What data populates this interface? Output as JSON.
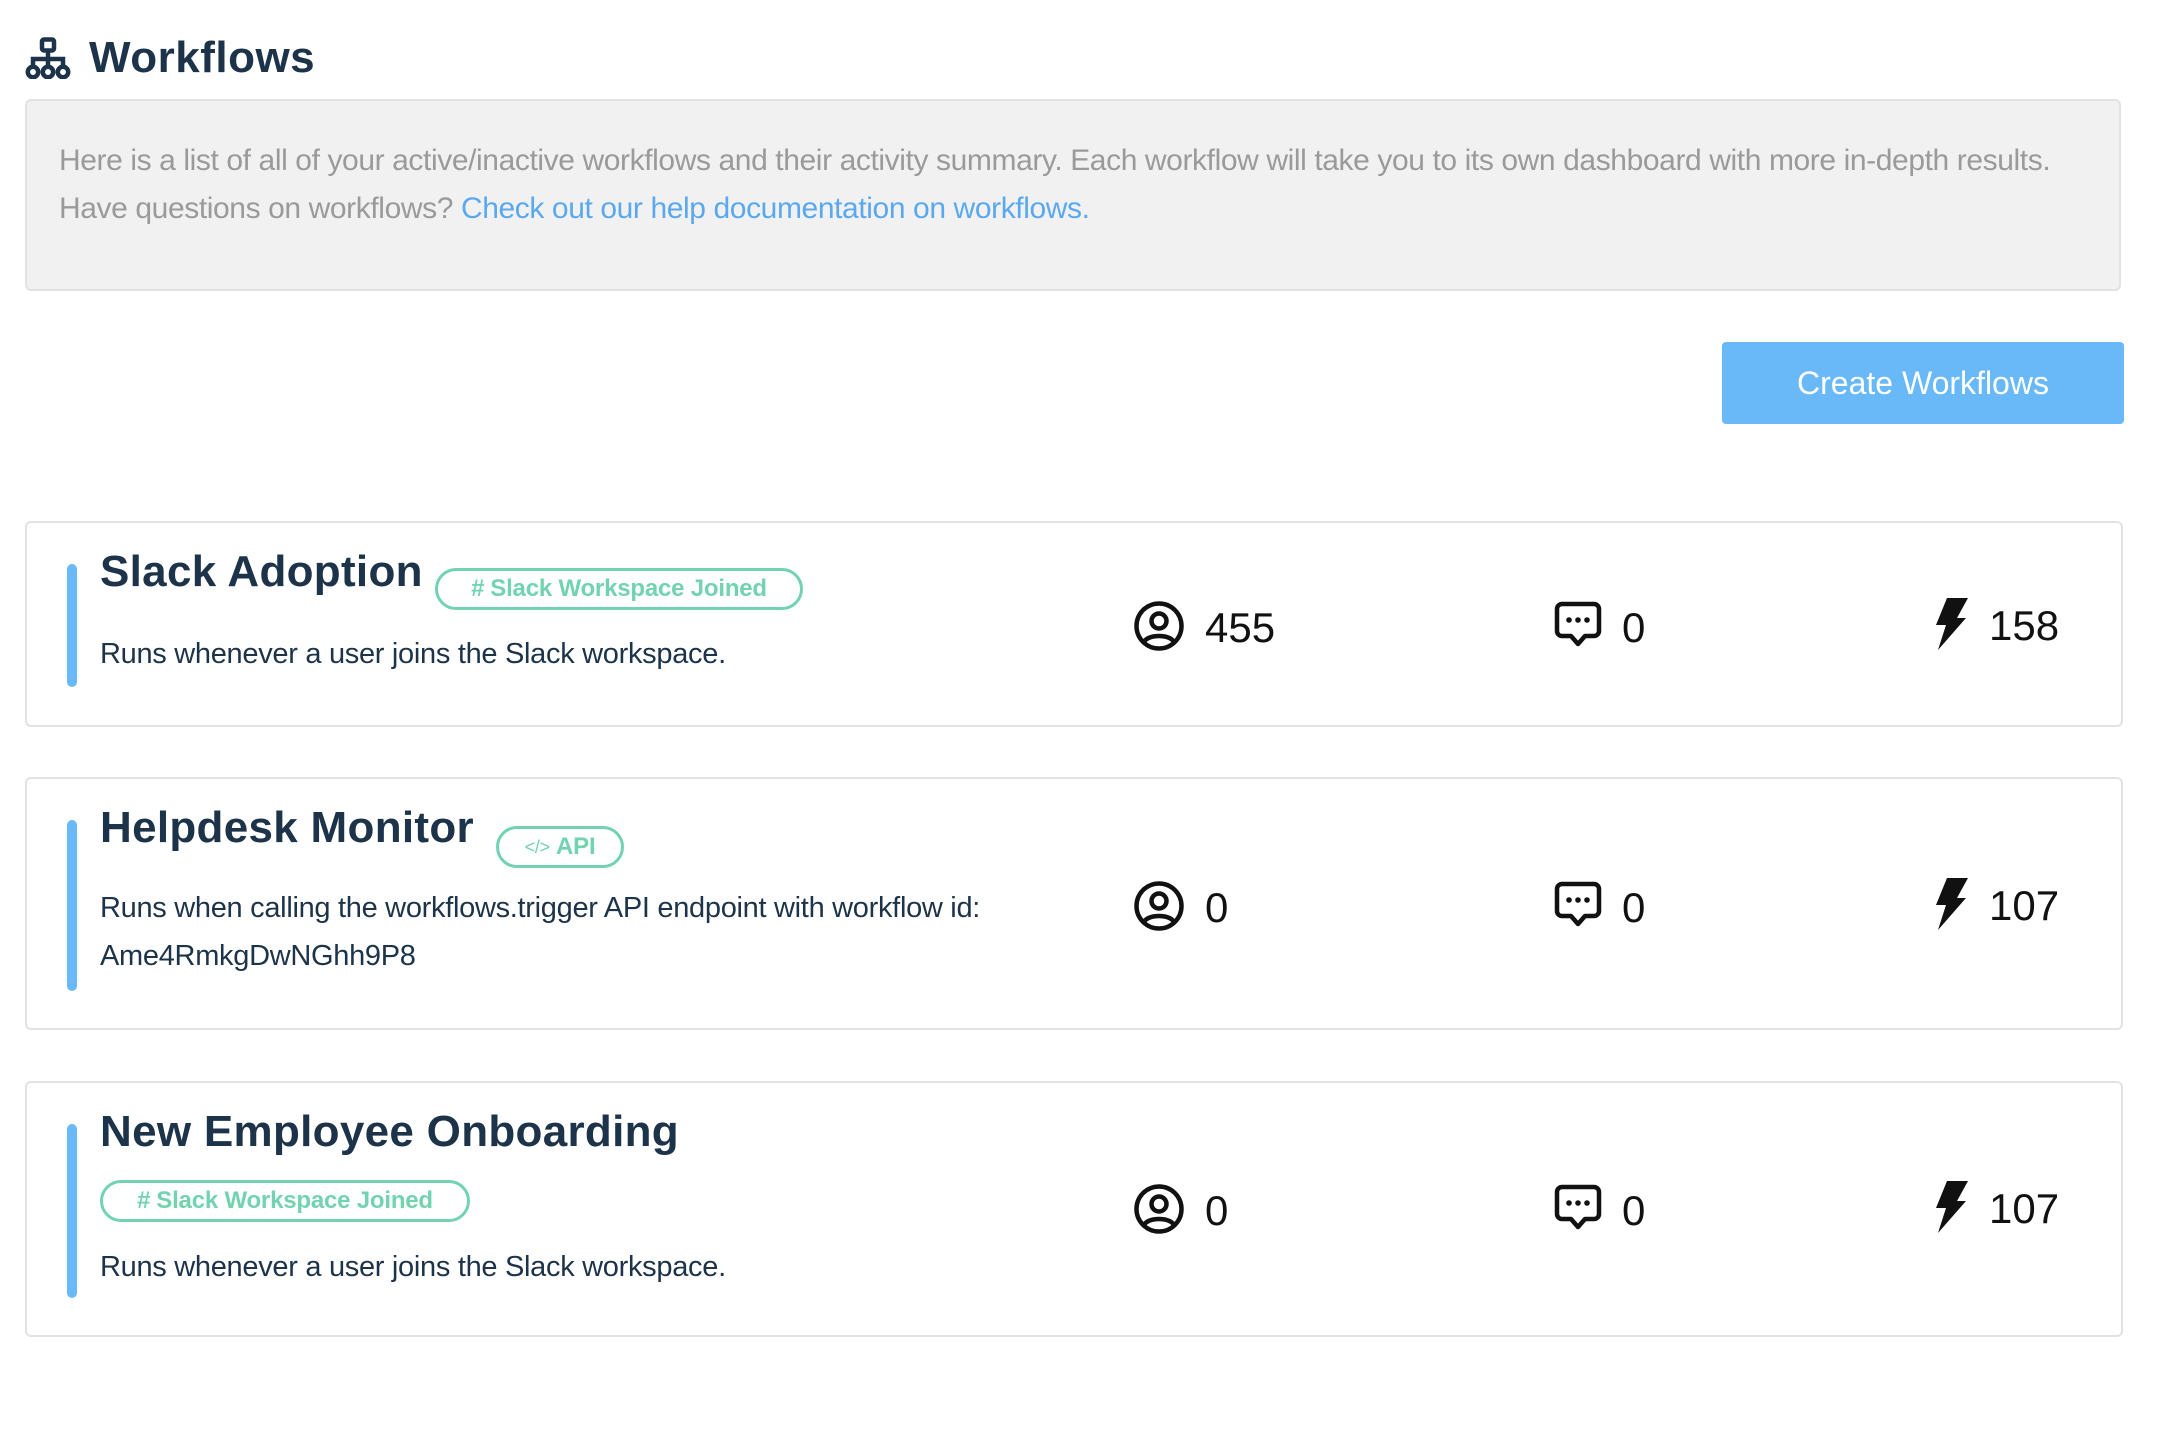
{
  "header": {
    "title": "Workflows",
    "icon": "sitemap-icon"
  },
  "info": {
    "text": "Here is a list of all of your active/inactive workflows and their activity summary. Each workflow will take you to its own dashboard with more in-depth results. Have questions on workflows? ",
    "link_label": "Check out our help documentation on workflows",
    "trailing": "."
  },
  "toolbar": {
    "create_label": "Create Workflows"
  },
  "colors": {
    "primary_text": "#1c3349",
    "accent_blue": "#69b8f7",
    "link_blue": "#5aa9ef",
    "badge_green": "#72d3b0",
    "info_bg": "#f1f1f1",
    "info_text": "#9a9a9a"
  },
  "stat_icons": {
    "users": "user-circle-icon",
    "messages": "message-dots-icon",
    "runs": "bolt-icon"
  },
  "workflows": [
    {
      "title": "Slack Adoption",
      "trigger": {
        "label": "Slack Workspace Joined",
        "icon": "slack-hash-icon",
        "glyph": "#"
      },
      "description": "Runs whenever a user joins the Slack workspace.",
      "users": "455",
      "messages": "0",
      "runs": "158"
    },
    {
      "title": "Helpdesk Monitor",
      "trigger": {
        "label": "API",
        "icon": "code-icon",
        "glyph": "</>"
      },
      "description": "Runs when calling the workflows.trigger API endpoint with workflow id: Ame4RmkgDwNGhh9P8",
      "users": "0",
      "messages": "0",
      "runs": "107"
    },
    {
      "title": "New Employee Onboarding",
      "trigger": {
        "label": "Slack Workspace Joined",
        "icon": "slack-hash-icon",
        "glyph": "#"
      },
      "description": "Runs whenever a user joins the Slack workspace.",
      "users": "0",
      "messages": "0",
      "runs": "107"
    }
  ]
}
